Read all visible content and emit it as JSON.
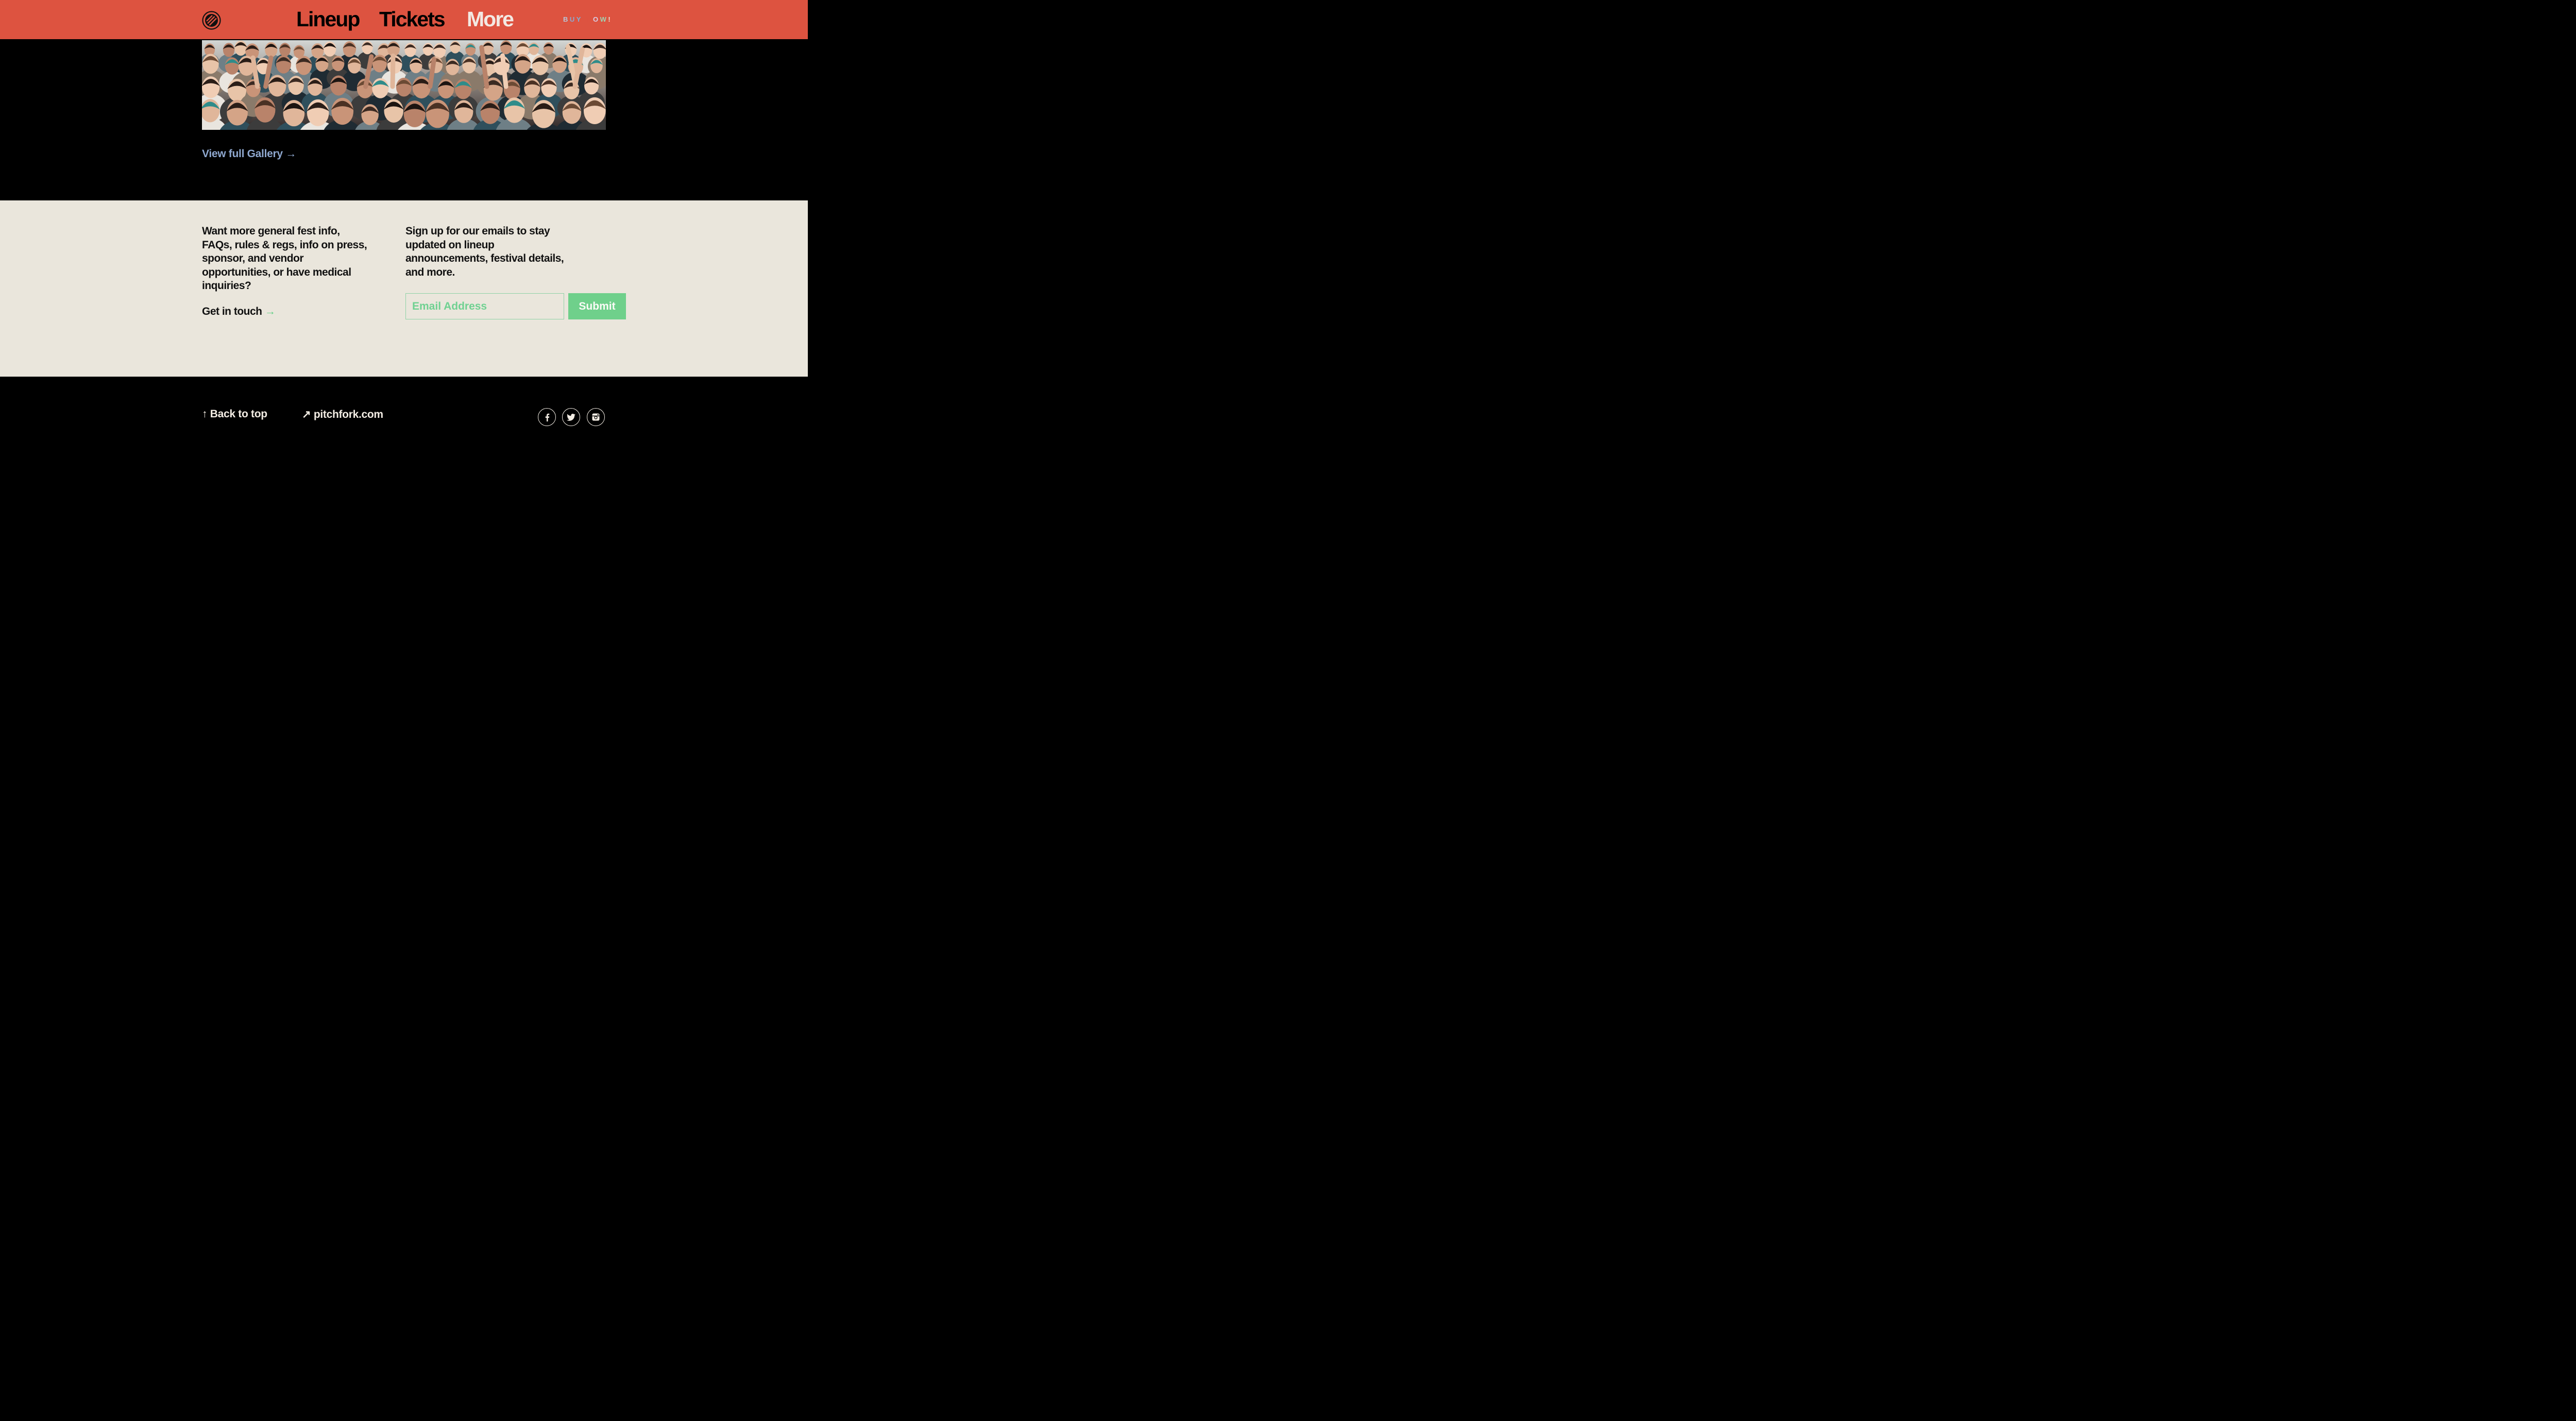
{
  "colors": {
    "header_bg": "#dd5340",
    "info_bg": "#eae6dc",
    "gallery_link": "#8fa8cf",
    "accent_green": "#6fd08b",
    "footer_text": "#f3ede4"
  },
  "header": {
    "logo_icon": "pitchfork-logo-icon",
    "nav": {
      "lineup": "Lineup",
      "tickets": "Tickets",
      "more": "More"
    },
    "buy_now": {
      "label": "BUY NOW!",
      "letter_colors": [
        "#b9c4d6",
        "#8fa8cf",
        "#7fb0d8",
        "#dd5340",
        "#d8cfe6",
        "#9fd3b2",
        "#f0e6da",
        "#e2c9c0"
      ]
    }
  },
  "gallery": {
    "image_alt": "festival crowd",
    "link_label": "View full Gallery",
    "link_arrow": "→"
  },
  "info": {
    "question": "Want more general fest info, FAQs, rules & regs, info on press, sponsor, and vendor opportunities, or have medical inquiries?",
    "contact_label": "Get in touch",
    "contact_arrow": "→",
    "signup_text": "Sign up for our emails to stay updated on lineup announcements, festival details, and more.",
    "email_placeholder": "Email Address",
    "email_value": "",
    "submit_label": "Submit"
  },
  "footer": {
    "back_to_top": "↑ Back to top",
    "pitchfork": "↗ pitchfork.com",
    "social": [
      "facebook-icon",
      "twitter-icon",
      "instagram-icon"
    ]
  }
}
